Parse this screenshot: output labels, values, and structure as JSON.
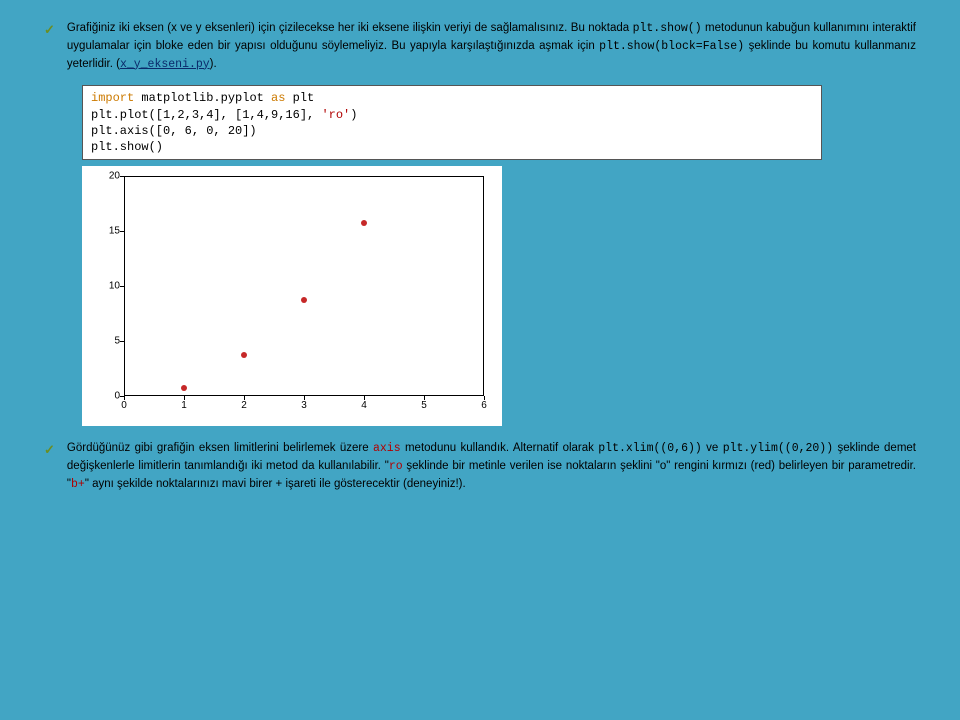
{
  "para1": {
    "t1": "Grafiğiniz iki eksen (x ve y eksenleri) için çizilecekse her iki eksene ilişkin veriyi de sağlamalısınız. Bu noktada ",
    "c1": "plt.show()",
    "t2": " metodunun kabuğun kullanımını interaktif uygulamalar için bloke eden bir yapısı olduğunu söylemeliyiz. Bu yapıyla karşılaştığınızda aşmak için ",
    "c2": "plt.show(block=False)",
    "t3": " şeklinde bu komutu kullanmanız yeterlidir. (",
    "l1": "x_y_ekseni.py",
    "t4": ")."
  },
  "code": {
    "l1a": "import",
    "l1b": " matplotlib.pyplot ",
    "l1c": "as",
    "l1d": " plt",
    "l2a": "plt.plot([1,2,3,4], [1,4,9,16], ",
    "l2b": "'ro'",
    "l2c": ")",
    "l3": "plt.axis([0, 6, 0, 20])",
    "l4": "plt.show()"
  },
  "chart_data": {
    "type": "scatter",
    "x": [
      1,
      2,
      3,
      4
    ],
    "y": [
      1,
      4,
      9,
      16
    ],
    "xlim": [
      0,
      6
    ],
    "ylim": [
      0,
      20
    ],
    "yticks": [
      0,
      5,
      10,
      15,
      20
    ],
    "xticks": [
      0,
      1,
      2,
      3,
      4,
      5,
      6
    ],
    "marker": "ro",
    "title": "",
    "xlabel": "",
    "ylabel": ""
  },
  "para2": {
    "t1": "Gördüğünüz gibi grafiğin eksen limitlerini belirlemek üzere ",
    "c1": "axis",
    "t2": " metodunu kullandık. Alternatif olarak ",
    "c2": "plt.xlim((0,6))",
    "t3": " ve ",
    "c3": "plt.ylim((0,20))",
    "t4": " şeklinde demet değişkenlerle limitlerin tanımlandığı iki metod da kullanılabilir. \"",
    "c4": "ro",
    "t5": " şeklinde bir metinle verilen ise noktaların şeklini \"o\" rengini kırmızı (red) belirleyen bir parametredir. \"",
    "c5": "b+",
    "t6": "\" aynı şekilde noktalarınızı mavi birer + işareti ile gösterecektir (deneyiniz!)."
  }
}
